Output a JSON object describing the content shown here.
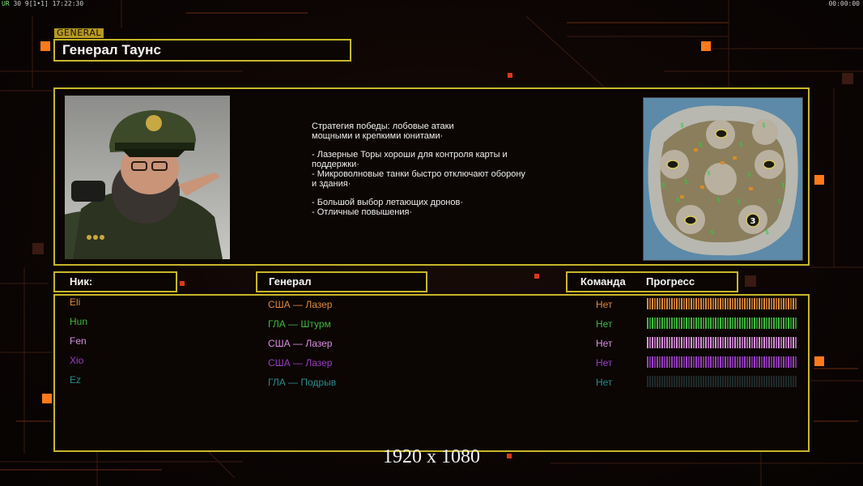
{
  "hud": {
    "left_text": "30 9[1•1] 17:22:30",
    "left_prefix": "UR",
    "right_text": "00:00:00"
  },
  "general": {
    "tag": "GENERAL",
    "name": "Генерал Таунс",
    "portrait_icon": "general-townes-portrait"
  },
  "description": {
    "line1": "Стратегия победы: лобовые атаки\nмощными и крепкими юнитами·",
    "line2": "- Лазерные Торы хороши для контроля карты и\n  поддержки·\n- Микроволновые танки быстро отключают оборону\n  и здания·",
    "line3": "- Большой выбор летающих дронов·\n- Отличные повышения·"
  },
  "map": {
    "icon": "minimap-thumbnail",
    "start_marker": "3"
  },
  "table": {
    "col_nick": "Ник:",
    "col_general": "Генерал",
    "col_team": "Команда",
    "col_progress": "Прогресс"
  },
  "players": [
    {
      "nick": "Eli",
      "general": "США — Лазер",
      "team": "Нет",
      "color": "#e08a3a",
      "progress": 1.0
    },
    {
      "nick": "Hun",
      "general": "ГЛА — Штурм",
      "team": "Нет",
      "color": "#3fb83f",
      "progress": 1.0
    },
    {
      "nick": "Fen",
      "general": "США — Лазер",
      "team": "Нет",
      "color": "#d98fe0",
      "progress": 1.0
    },
    {
      "nick": "Xio",
      "general": "США — Лазер",
      "team": "Нет",
      "color": "#9a3fc4",
      "progress": 1.0
    },
    {
      "nick": "Ez",
      "general": "ГЛА — Подрыв",
      "team": "Нет",
      "color": "#2a8c8c",
      "progress": 0.0
    }
  ],
  "footer": {
    "resolution": "1920 x 1080"
  }
}
